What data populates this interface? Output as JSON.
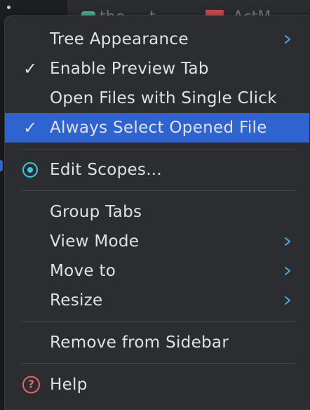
{
  "background": {
    "tab1_text": "the ...  t",
    "tab2_text": "ActM"
  },
  "menu": {
    "items": [
      {
        "label": "Tree Appearance",
        "submenu": true,
        "checked": false
      },
      {
        "label": "Enable Preview Tab",
        "submenu": false,
        "checked": true
      },
      {
        "label": "Open Files with Single Click",
        "submenu": false,
        "checked": false
      },
      {
        "label": "Always Select Opened File",
        "submenu": false,
        "checked": true,
        "highlighted": true
      },
      {
        "label": "Edit Scopes...",
        "submenu": false,
        "icon": "scope-icon"
      },
      {
        "label": "Group Tabs",
        "submenu": false
      },
      {
        "label": "View Mode",
        "submenu": true
      },
      {
        "label": "Move to",
        "submenu": true
      },
      {
        "label": "Resize",
        "submenu": true
      },
      {
        "label": "Remove from Sidebar",
        "submenu": false
      },
      {
        "label": "Help",
        "submenu": false,
        "icon": "help-icon"
      }
    ],
    "check_glyph": "✓",
    "help_glyph": "?"
  },
  "colors": {
    "menu_bg": "#2b2d30",
    "highlight": "#2f63cf",
    "scope_icon": "#3ec6e0",
    "help_icon": "#e46473",
    "chevron": "#4aa7e0"
  }
}
